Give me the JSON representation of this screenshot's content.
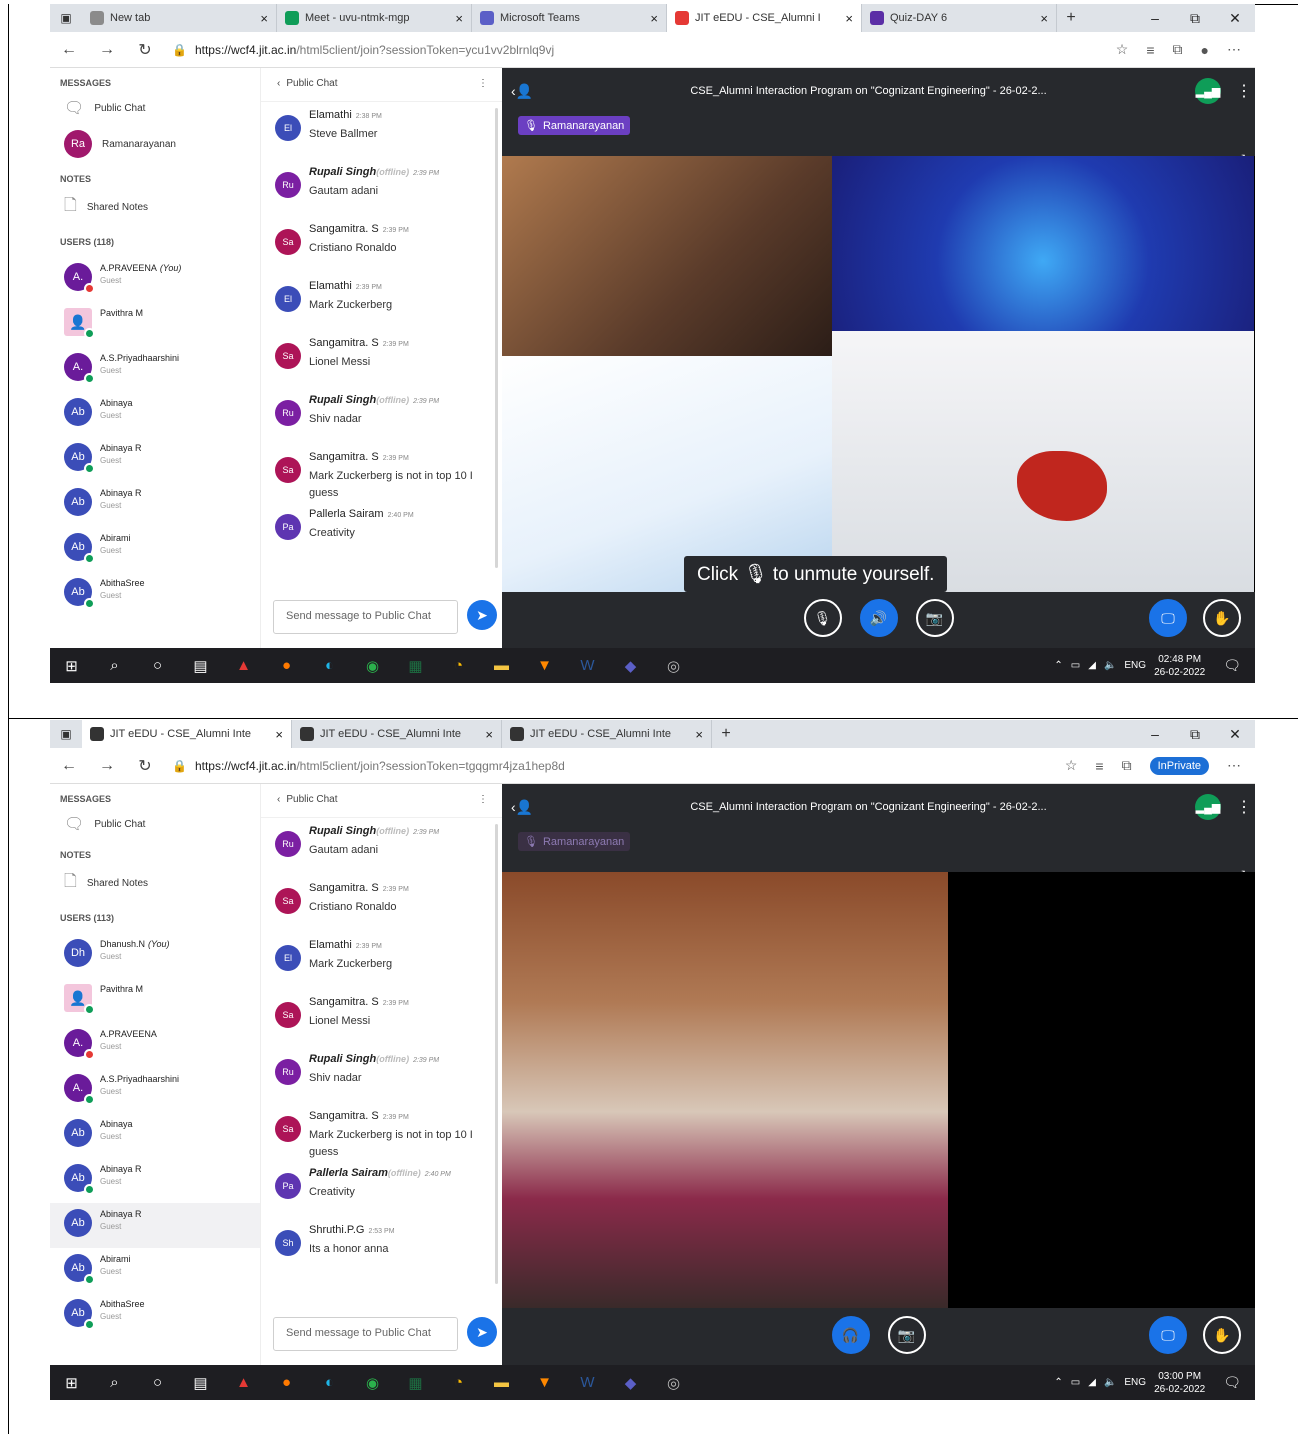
{
  "screens": [
    {
      "tabs": [
        {
          "label": "New tab",
          "color": "#8b8b8b"
        },
        {
          "label": "Meet - uvu-ntmk-mgp",
          "color": "#0f9d58"
        },
        {
          "label": "Microsoft Teams",
          "color": "#5b5fc7"
        },
        {
          "label": "JIT eEDU - CSE_Alumni I",
          "color": "#e53935"
        },
        {
          "label": "Quiz-DAY 6",
          "color": "#5b2ea6"
        }
      ],
      "url_host": "https://wcf4.jit.ac.in",
      "url_path": "/html5client/join?sessionToken=ycu1vv2blrnlq9vj",
      "inprivate": "",
      "sidebar": {
        "messages_header": "MESSAGES",
        "public_chat": "Public Chat",
        "pinned_user": {
          "initials": "Ra",
          "name": "Ramanarayanan"
        },
        "notes_header": "NOTES",
        "shared_notes": "Shared Notes",
        "users_header": "USERS (118)",
        "users": [
          {
            "initials": "A.",
            "name": "A.PRAVEENA",
            "you": "(You)",
            "role": "Guest",
            "status": "red"
          },
          {
            "initials": "",
            "name": "Pavithra M",
            "you": "",
            "role": "",
            "status": "green",
            "photo": true
          },
          {
            "initials": "A.",
            "name": "A.S.Priyadhaarshini",
            "you": "",
            "role": "Guest",
            "status": "green"
          },
          {
            "initials": "Ab",
            "name": "Abinaya",
            "you": "",
            "role": "Guest",
            "status": ""
          },
          {
            "initials": "Ab",
            "name": "Abinaya R",
            "you": "",
            "role": "Guest",
            "status": "green"
          },
          {
            "initials": "Ab",
            "name": "Abinaya R",
            "you": "",
            "role": "Guest",
            "status": ""
          },
          {
            "initials": "Ab",
            "name": "Abirami",
            "you": "",
            "role": "Guest",
            "status": "green"
          },
          {
            "initials": "Ab",
            "name": "AbithaSree",
            "you": "",
            "role": "Guest",
            "status": "green"
          }
        ]
      },
      "chat": {
        "back_label": "Public Chat",
        "input_placeholder": "Send message to Public Chat",
        "messages": [
          {
            "initials": "El",
            "name": "Elamathi",
            "offline": "",
            "time": "2:38 PM",
            "text": "Steve Ballmer"
          },
          {
            "initials": "Ru",
            "name": "Rupali Singh",
            "offline": "(offline)",
            "time": "2:39 PM",
            "text": "Gautam adani"
          },
          {
            "initials": "Sa",
            "name": "Sangamitra. S",
            "offline": "",
            "time": "2:39 PM",
            "text": "Cristiano Ronaldo"
          },
          {
            "initials": "El",
            "name": "Elamathi",
            "offline": "",
            "time": "2:39 PM",
            "text": "Mark Zuckerberg"
          },
          {
            "initials": "Sa",
            "name": "Sangamitra. S",
            "offline": "",
            "time": "2:39 PM",
            "text": "Lionel Messi"
          },
          {
            "initials": "Ru",
            "name": "Rupali Singh",
            "offline": "(offline)",
            "time": "2:39 PM",
            "text": "Shiv nadar"
          },
          {
            "initials": "Sa",
            "name": "Sangamitra. S",
            "offline": "",
            "time": "2:39 PM",
            "text": "Mark Zuckerberg is not in top 10 I guess"
          },
          {
            "initials": "Pa",
            "name": "Pallerla Sairam",
            "offline": "",
            "time": "2:40 PM",
            "text": "Creativity"
          }
        ]
      },
      "meeting": {
        "title": "CSE_Alumni Interaction Program on \"Cognizant Engineering\" - 26-02-2...",
        "talker": "Ramanarayanan",
        "toast": "Click 🎙 to unmute yourself."
      },
      "taskbar": {
        "lang": "ENG",
        "time": "02:48 PM",
        "date": "26-02-2022"
      }
    },
    {
      "tabs": [
        {
          "label": "JIT eEDU - CSE_Alumni Inte",
          "color": "#333"
        },
        {
          "label": "JIT eEDU - CSE_Alumni Inte",
          "color": "#333"
        },
        {
          "label": "JIT eEDU - CSE_Alumni Inte",
          "color": "#333"
        }
      ],
      "url_host": "https://wcf4.jit.ac.in",
      "url_path": "/html5client/join?sessionToken=tgqgmr4jza1hep8d",
      "inprivate": "InPrivate",
      "sidebar": {
        "messages_header": "MESSAGES",
        "public_chat": "Public Chat",
        "notes_header": "NOTES",
        "shared_notes": "Shared Notes",
        "users_header": "USERS (113)",
        "users": [
          {
            "initials": "Dh",
            "name": "Dhanush.N",
            "you": "(You)",
            "role": "Guest",
            "status": ""
          },
          {
            "initials": "",
            "name": "Pavithra M",
            "you": "",
            "role": "",
            "status": "green",
            "photo": true
          },
          {
            "initials": "A.",
            "name": "A.PRAVEENA",
            "you": "",
            "role": "Guest",
            "status": "red"
          },
          {
            "initials": "A.",
            "name": "A.S.Priyadhaarshini",
            "you": "",
            "role": "Guest",
            "status": "green"
          },
          {
            "initials": "Ab",
            "name": "Abinaya",
            "you": "",
            "role": "Guest",
            "status": ""
          },
          {
            "initials": "Ab",
            "name": "Abinaya R",
            "you": "",
            "role": "Guest",
            "status": "green"
          },
          {
            "initials": "Ab",
            "name": "Abinaya R",
            "you": "",
            "role": "Guest",
            "status": ""
          },
          {
            "initials": "Ab",
            "name": "Abirami",
            "you": "",
            "role": "Guest",
            "status": "green"
          },
          {
            "initials": "Ab",
            "name": "AbithaSree",
            "you": "",
            "role": "Guest",
            "status": "green"
          }
        ]
      },
      "chat": {
        "back_label": "Public Chat",
        "input_placeholder": "Send message to Public Chat",
        "messages": [
          {
            "initials": "Ru",
            "name": "Rupali Singh",
            "offline": "(offline)",
            "time": "2:39 PM",
            "text": "Gautam adani"
          },
          {
            "initials": "Sa",
            "name": "Sangamitra. S",
            "offline": "",
            "time": "2:39 PM",
            "text": "Cristiano Ronaldo"
          },
          {
            "initials": "El",
            "name": "Elamathi",
            "offline": "",
            "time": "2:39 PM",
            "text": "Mark Zuckerberg"
          },
          {
            "initials": "Sa",
            "name": "Sangamitra. S",
            "offline": "",
            "time": "2:39 PM",
            "text": "Lionel Messi"
          },
          {
            "initials": "Ru",
            "name": "Rupali Singh",
            "offline": "(offline)",
            "time": "2:39 PM",
            "text": "Shiv nadar"
          },
          {
            "initials": "Sa",
            "name": "Sangamitra. S",
            "offline": "",
            "time": "2:39 PM",
            "text": "Mark Zuckerberg is not in top 10 I guess"
          },
          {
            "initials": "Pa",
            "name": "Pallerla Sairam",
            "offline": "(offline)",
            "time": "2:40 PM",
            "text": "Creativity"
          },
          {
            "initials": "Sh",
            "name": "Shruthi.P.G",
            "offline": "",
            "time": "2:53 PM",
            "text": "Its a honor anna"
          }
        ]
      },
      "meeting": {
        "title": "CSE_Alumni Interaction Program on \"Cognizant Engineering\" - 26-02-2...",
        "talker": "Ramanarayanan",
        "toast": ""
      },
      "taskbar": {
        "lang": "ENG",
        "time": "03:00 PM",
        "date": "26-02-2022"
      }
    }
  ]
}
